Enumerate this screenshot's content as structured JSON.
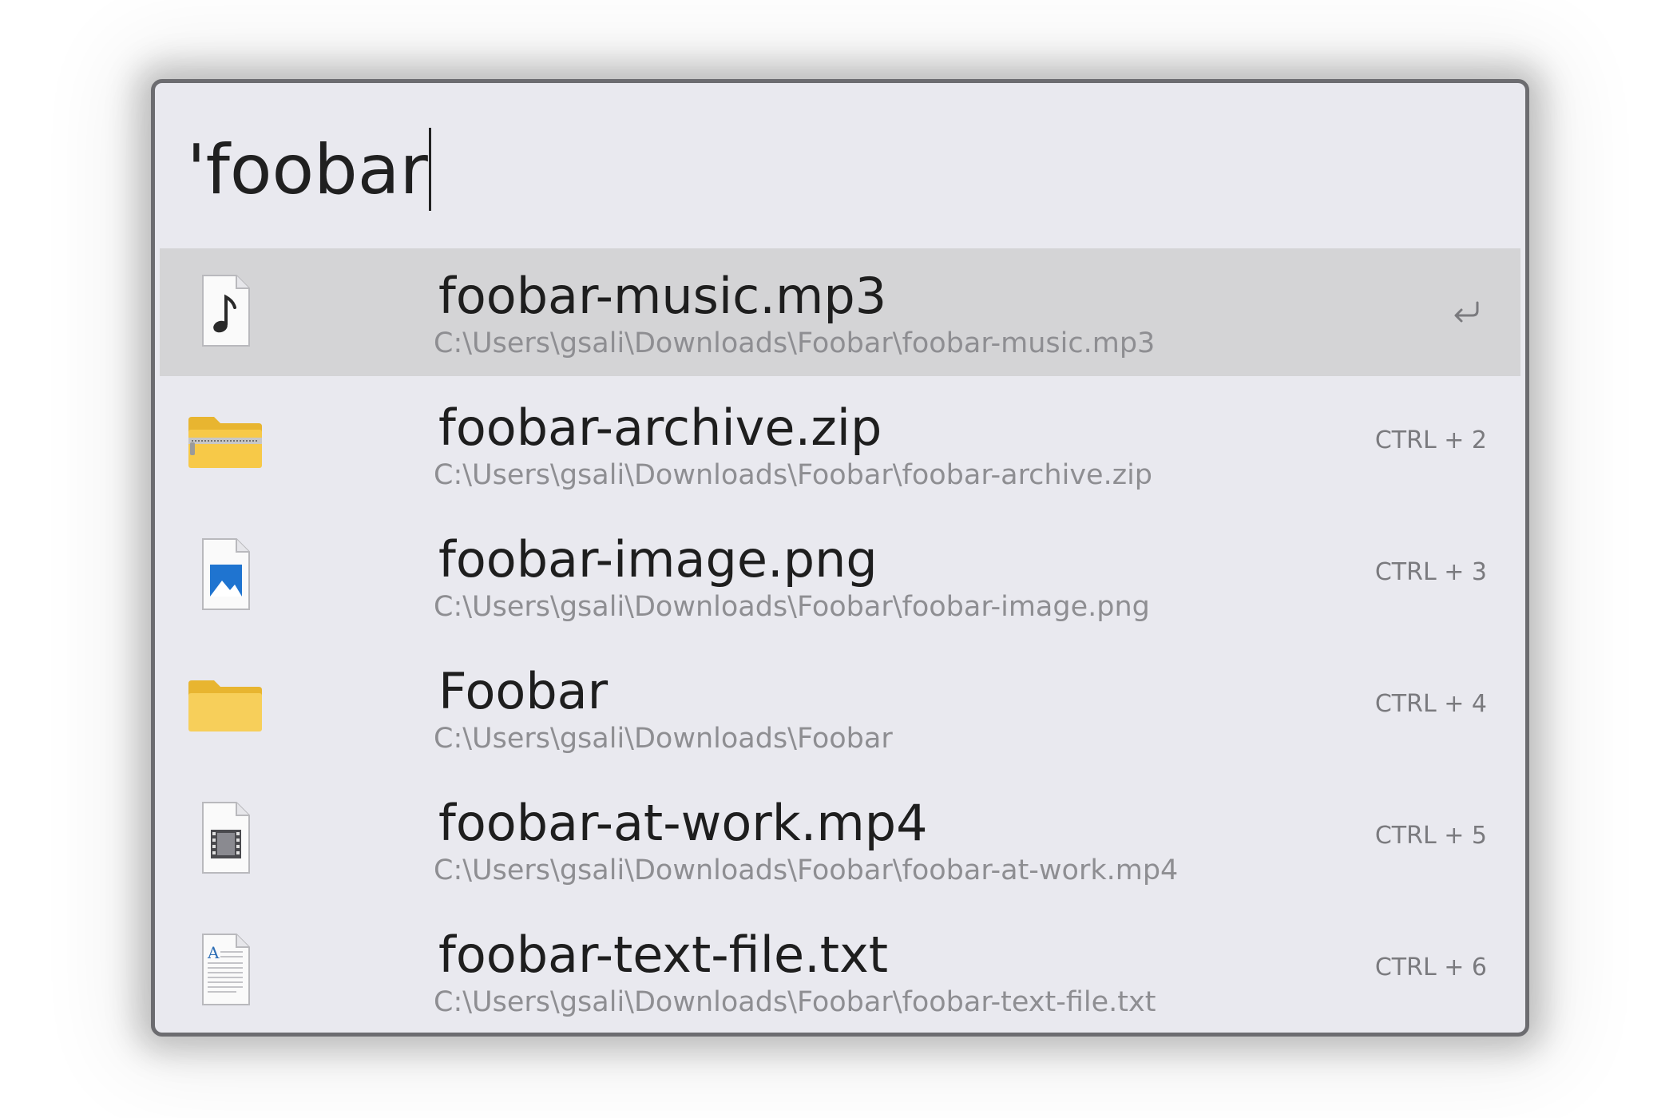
{
  "search": {
    "query": "'foobar"
  },
  "results": [
    {
      "title": "foobar-music.mp3",
      "path": "C:\\Users\\gsali\\Downloads\\Foobar\\foobar-music.mp3",
      "icon": "music-file-icon",
      "selected": true,
      "action_icon": "enter-icon"
    },
    {
      "title": "foobar-archive.zip",
      "path": "C:\\Users\\gsali\\Downloads\\Foobar\\foobar-archive.zip",
      "icon": "zip-folder-icon",
      "shortcut": "CTRL + 2"
    },
    {
      "title": "foobar-image.png",
      "path": "C:\\Users\\gsali\\Downloads\\Foobar\\foobar-image.png",
      "icon": "image-file-icon",
      "shortcut": "CTRL + 3"
    },
    {
      "title": "Foobar",
      "path": "C:\\Users\\gsali\\Downloads\\Foobar",
      "icon": "folder-icon",
      "shortcut": "CTRL + 4"
    },
    {
      "title": "foobar-at-work.mp4",
      "path": "C:\\Users\\gsali\\Downloads\\Foobar\\foobar-at-work.mp4",
      "icon": "video-file-icon",
      "shortcut": "CTRL + 5"
    },
    {
      "title": "foobar-text-file.txt",
      "path": "C:\\Users\\gsali\\Downloads\\Foobar\\foobar-text-file.txt",
      "icon": "text-file-icon",
      "shortcut": "CTRL + 6"
    }
  ],
  "colors": {
    "window_bg": "#e9e9ef",
    "selected_bg": "#d4d4d6",
    "border": "#6c6c70",
    "title_text": "#1e1e1e",
    "path_text": "#8e8e92",
    "folder_yellow": "#f7c948",
    "image_blue": "#1f74d0"
  }
}
